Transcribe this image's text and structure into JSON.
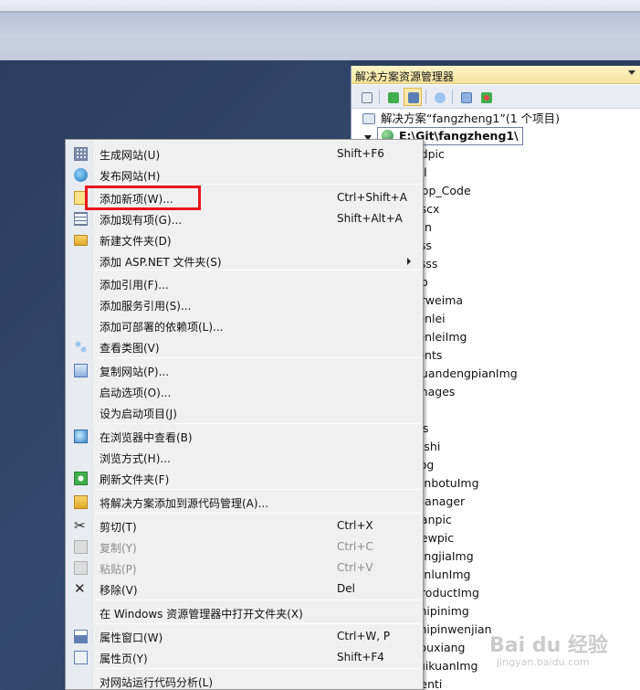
{
  "solution_explorer": {
    "title": "解决方案资源管理器",
    "solution_label": "解决方案“fangzheng1”(1 个项目)",
    "project_label": "E:\\Git\\fangzheng1\\",
    "folders": [
      "adpic",
      "all",
      "App_Code",
      "ascx",
      "Bin",
      "css",
      "csss",
      "db",
      "erweima",
      "fenlei",
      "fenleiImg",
      "fonts",
      "guandengpianImg",
      "images",
      "js",
      "jss",
      "lnshi",
      "Log",
      "lunbotuImg",
      "manager",
      "nanpic",
      "newpic",
      "pingjiaImg",
      "pinlunImg",
      "productImg",
      "shipinimg",
      "shipinwenjian",
      "souxiang",
      "tuikuanImg",
      "venti"
    ]
  },
  "context_menu": {
    "items": [
      {
        "label": "生成网站(U)",
        "shortcut": "Shift+F6",
        "icon": "build-icon",
        "enabled": true
      },
      {
        "label": "发布网站(H)",
        "shortcut": "",
        "icon": "publish-icon",
        "enabled": true
      },
      {
        "label": "添加新项(W)...",
        "shortcut": "Ctrl+Shift+A",
        "icon": "add-new-item-icon",
        "enabled": true,
        "highlighted": true
      },
      {
        "label": "添加现有项(G)...",
        "shortcut": "Shift+Alt+A",
        "icon": "add-existing-item-icon",
        "enabled": true
      },
      {
        "label": "新建文件夹(D)",
        "shortcut": "",
        "icon": "new-folder-icon",
        "enabled": true
      },
      {
        "label": "添加 ASP.NET 文件夹(S)",
        "shortcut": "",
        "icon": "",
        "enabled": true,
        "submenu": true
      },
      {
        "label": "添加引用(F)...",
        "shortcut": "",
        "icon": "",
        "enabled": true
      },
      {
        "label": "添加服务引用(S)...",
        "shortcut": "",
        "icon": "",
        "enabled": true
      },
      {
        "label": "添加可部署的依赖项(L)...",
        "shortcut": "",
        "icon": "",
        "enabled": true
      },
      {
        "label": "查看类图(V)",
        "shortcut": "",
        "icon": "class-diagram-icon",
        "enabled": true
      },
      {
        "label": "复制网站(P)...",
        "shortcut": "",
        "icon": "copy-website-icon",
        "enabled": true
      },
      {
        "label": "启动选项(O)...",
        "shortcut": "",
        "icon": "",
        "enabled": true
      },
      {
        "label": "设为启动项目(J)",
        "shortcut": "",
        "icon": "",
        "enabled": true
      },
      {
        "label": "在浏览器中查看(B)",
        "shortcut": "",
        "icon": "view-in-browser-icon",
        "enabled": true
      },
      {
        "label": "浏览方式(H)...",
        "shortcut": "",
        "icon": "",
        "enabled": true
      },
      {
        "label": "刷新文件夹(F)",
        "shortcut": "",
        "icon": "refresh-icon",
        "enabled": true
      },
      {
        "label": "将解决方案添加到源代码管理(A)...",
        "shortcut": "",
        "icon": "add-to-source-control-icon",
        "enabled": true
      },
      {
        "label": "剪切(T)",
        "shortcut": "Ctrl+X",
        "icon": "scissors-icon",
        "enabled": true
      },
      {
        "label": "复制(Y)",
        "shortcut": "Ctrl+C",
        "icon": "copy-icon",
        "enabled": false
      },
      {
        "label": "粘贴(P)",
        "shortcut": "Ctrl+V",
        "icon": "paste-icon",
        "enabled": false
      },
      {
        "label": "移除(V)",
        "shortcut": "Del",
        "icon": "remove-icon",
        "enabled": true
      },
      {
        "label": "在 Windows 资源管理器中打开文件夹(X)",
        "shortcut": "",
        "icon": "",
        "enabled": true
      },
      {
        "label": "属性窗口(W)",
        "shortcut": "Ctrl+W, P",
        "icon": "properties-window-icon",
        "enabled": true
      },
      {
        "label": "属性页(Y)",
        "shortcut": "Shift+F4",
        "icon": "property-pages-icon",
        "enabled": true
      },
      {
        "label": "对网站运行代码分析(L)",
        "shortcut": "",
        "icon": "",
        "enabled": true
      }
    ]
  },
  "colors": {
    "highlight_box": "#e8161b",
    "panel_title_bg": "#f7e39a",
    "editor_bg": "#2c3e5f"
  },
  "watermark": {
    "text": "Bai du 经验",
    "sub": "jingyan.baidu.com"
  }
}
